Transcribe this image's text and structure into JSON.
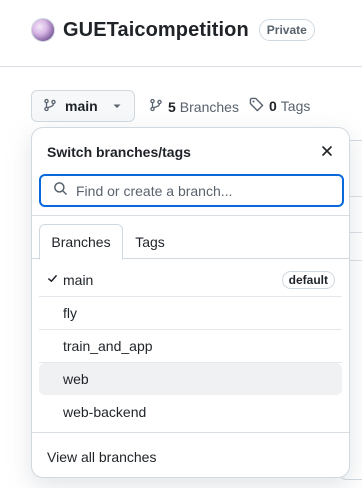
{
  "repo": {
    "name": "GUETaicompetition",
    "visibility": "Private",
    "avatar_icon": "avatar-image"
  },
  "branch_bar": {
    "current_branch": "main",
    "branches_count": "5",
    "branches_word": "Branches",
    "tags_count": "0",
    "tags_word": "Tags"
  },
  "dropdown": {
    "title": "Switch branches/tags",
    "search_placeholder": "Find or create a branch...",
    "tabs": [
      {
        "label": "Branches",
        "active": true
      },
      {
        "label": "Tags",
        "active": false
      }
    ],
    "branches": [
      {
        "name": "main",
        "selected": true,
        "badge": "default"
      },
      {
        "name": "fly",
        "selected": false
      },
      {
        "name": "train_and_app",
        "selected": false
      },
      {
        "name": "web",
        "selected": false,
        "hovered": true
      },
      {
        "name": "web-backend",
        "selected": false
      }
    ],
    "footer_link": "View all branches"
  },
  "colors": {
    "accent_focus": "#0969da",
    "text_primary": "#1f2328",
    "text_muted": "#59636e",
    "border": "#d1d9e0",
    "hover_row": "#f0f1f3"
  }
}
